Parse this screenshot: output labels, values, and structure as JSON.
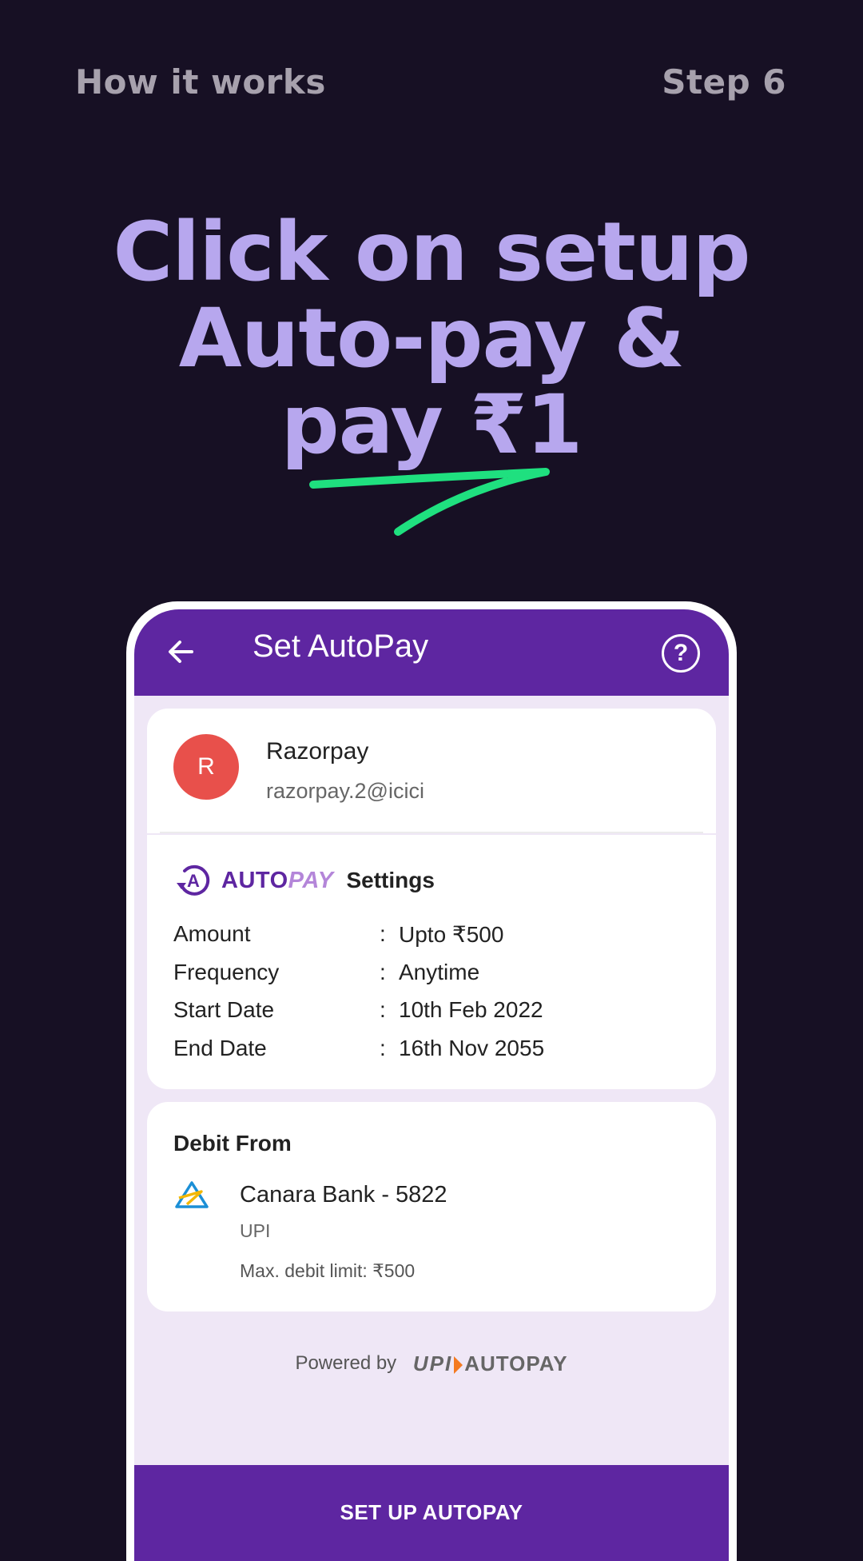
{
  "header": {
    "left_label": "How it works",
    "right_label": "Step 6"
  },
  "headline": {
    "line1": "Click on setup",
    "line2": "Auto-pay &",
    "line3": "pay ₹1"
  },
  "app": {
    "title": "Set AutoPay",
    "icons": {
      "back": "arrow-left",
      "help": "question-circle"
    },
    "merchant": {
      "avatar_letter": "R",
      "name": "Razorpay",
      "vpa": "razorpay.2@icici"
    },
    "autopay": {
      "logo_part1": "AUTO",
      "logo_part2": "PAY",
      "settings_label": "Settings",
      "rows": [
        {
          "label": "Amount",
          "sep": ":",
          "value": "Upto ₹500"
        },
        {
          "label": "Frequency",
          "sep": ":",
          "value": "Anytime"
        },
        {
          "label": "Start Date",
          "sep": ":",
          "value": "10th Feb 2022"
        },
        {
          "label": "End Date",
          "sep": ":",
          "value": "16th Nov 2055"
        }
      ]
    },
    "debit": {
      "title": "Debit From",
      "bank_name": "Canara Bank - 5822",
      "type": "UPI",
      "limit": "Max. debit limit: ₹500"
    },
    "powered_by": "Powered by",
    "upi_logo": {
      "upi": "UPI",
      "autopay": "AUTOPAY"
    },
    "cta_label": "SET UP AUTOPAY"
  },
  "colors": {
    "background": "#171024",
    "headline": "#b7a7ee",
    "accent_green": "#1fe07f",
    "brand_purple": "#5e26a1",
    "avatar_red": "#e8504b"
  }
}
